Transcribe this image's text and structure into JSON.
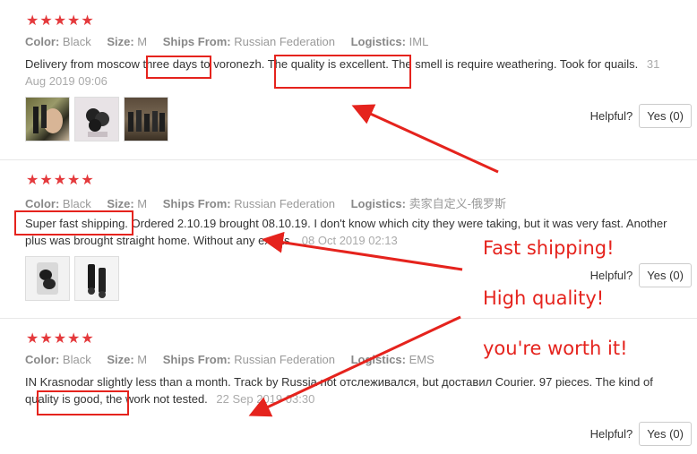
{
  "labels": {
    "color": "Color:",
    "size": "Size:",
    "ships_from": "Ships From:",
    "logistics": "Logistics:",
    "helpful": "Helpful?"
  },
  "reviews": [
    {
      "stars": "★★★★★",
      "color": "Black",
      "size": "M",
      "ships_from": "Russian Federation",
      "logistics": "IML",
      "text": "Delivery from moscow three days to voronezh. The quality is excellent. The smell is require weathering. Took for quails.",
      "date": "31 Aug 2019 09:06",
      "yes_label": "Yes (0)"
    },
    {
      "stars": "★★★★★",
      "color": "Black",
      "size": "M",
      "ships_from": "Russian Federation",
      "logistics": "卖家自定义-俄罗斯",
      "text": "Super fast shipping. Ordered 2.10.19 brought 08.10.19. I don't know which city they were taking, but it was very fast. Another plus was brought straight home. Without any extras.",
      "date": "08 Oct 2019 02:13",
      "yes_label": "Yes (0)"
    },
    {
      "stars": "★★★★★",
      "color": "Black",
      "size": "M",
      "ships_from": "Russian Federation",
      "logistics": "EMS",
      "text": "IN Krasnodar slightly less than a month. Track by Russia not отслеживался, but доставил Courier. 97 pieces. The kind of quality is good, the work not tested.",
      "date": "22 Sep 2019 03:30",
      "yes_label": "Yes (0)"
    }
  ],
  "annotations": {
    "line1": "Fast shipping!",
    "line2": "High quality!",
    "line3": "you're worth it!",
    "color": "#e5231d"
  }
}
